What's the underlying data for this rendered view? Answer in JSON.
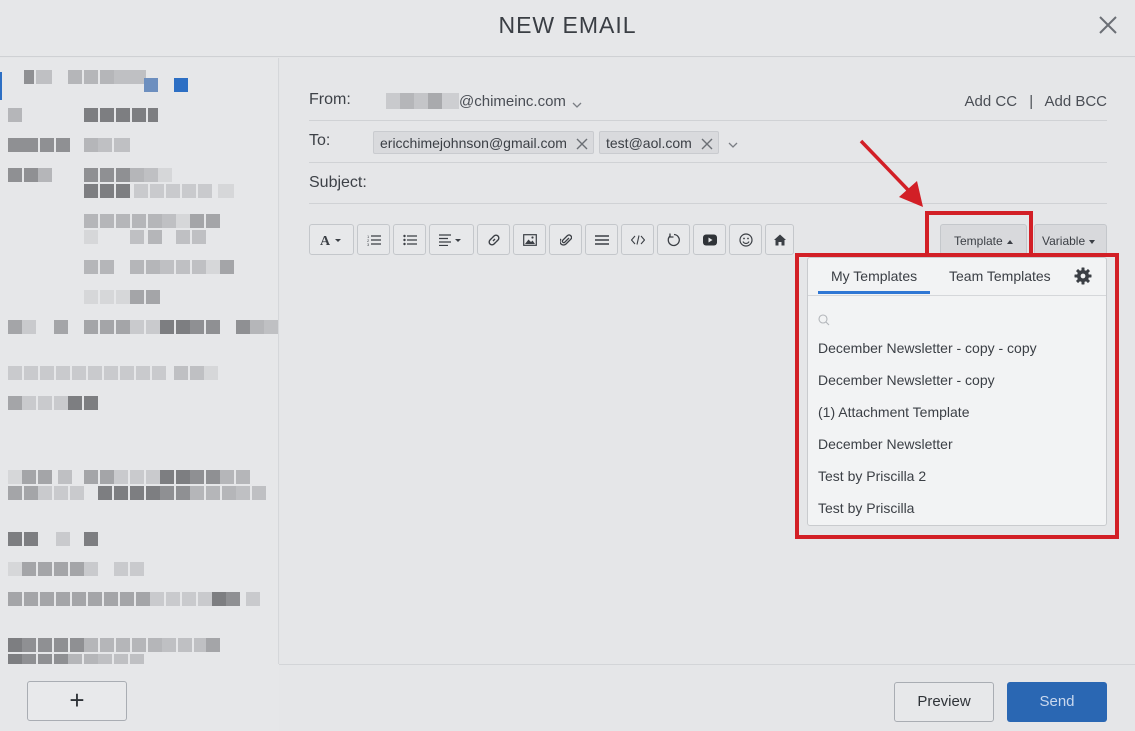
{
  "header": {
    "title": "NEW EMAIL"
  },
  "compose": {
    "from_label": "From:",
    "from_address": "@chimeinc.com",
    "add_cc": "Add CC",
    "separator": "|",
    "add_bcc": "Add BCC",
    "to_label": "To:",
    "recipients": [
      "ericchimejohnson@gmail.com",
      "test@aol.com"
    ],
    "subject_label": "Subject:",
    "subject_value": ""
  },
  "toolbar": {
    "template_label": "Template",
    "variable_label": "Variable"
  },
  "template_dropdown": {
    "tabs": [
      "My Templates",
      "Team Templates"
    ],
    "active_tab": "My Templates",
    "search_placeholder": "",
    "items": [
      "December Newsletter - copy - copy",
      "December Newsletter - copy",
      "(1) Attachment Template",
      "December Newsletter",
      "Test by Priscilla 2",
      "Test by Priscilla"
    ]
  },
  "footer": {
    "add_label": "+",
    "preview_label": "Preview",
    "send_label": "Send"
  },
  "colors": {
    "accent": "#2f77d4",
    "send_button": "#2a67b3",
    "highlight": "#d21f26"
  }
}
